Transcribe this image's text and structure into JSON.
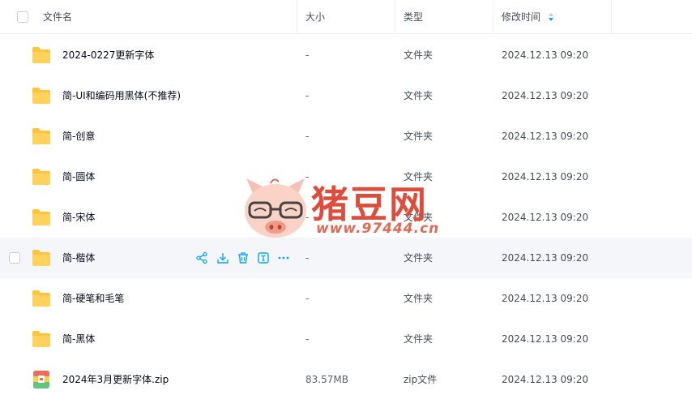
{
  "header": {
    "name_label": "文件名",
    "size_label": "大小",
    "type_label": "类型",
    "time_label": "修改时间"
  },
  "rows": [
    {
      "name": "2024-0227更新字体",
      "size": "-",
      "type": "文件夹",
      "time": "2024.12.13 09:20",
      "icon": "folder-icon"
    },
    {
      "name": "简-UI和编码用黑体(不推荐)",
      "size": "-",
      "type": "文件夹",
      "time": "2024.12.13 09:20",
      "icon": "folder-icon"
    },
    {
      "name": "简-创意",
      "size": "-",
      "type": "文件夹",
      "time": "2024.12.13 09:20",
      "icon": "folder-icon"
    },
    {
      "name": "简-圆体",
      "size": "-",
      "type": "文件夹",
      "time": "2024.12.13 09:20",
      "icon": "folder-icon"
    },
    {
      "name": "简-宋体",
      "size": "-",
      "type": "文件夹",
      "time": "2024.12.13 09:20",
      "icon": "folder-icon"
    },
    {
      "name": "简-楷体",
      "size": "-",
      "type": "文件夹",
      "time": "2024.12.13 09:20",
      "icon": "folder-icon",
      "hovered": true
    },
    {
      "name": "简-硬笔和毛笔",
      "size": "-",
      "type": "文件夹",
      "time": "2024.12.13 09:20",
      "icon": "folder-icon"
    },
    {
      "name": "简-黑体",
      "size": "-",
      "type": "文件夹",
      "time": "2024.12.13 09:20",
      "icon": "folder-icon"
    },
    {
      "name": "2024年3月更新字体.zip",
      "size": "83.57MB",
      "type": "zip文件",
      "time": "2024.12.13 09:20",
      "icon": "zip-file-icon"
    }
  ],
  "row_actions": [
    "share-icon",
    "download-icon",
    "delete-icon",
    "rename-icon",
    "more-icon"
  ],
  "watermark": {
    "title": "猪豆网",
    "url": "www.97444.cn"
  },
  "colors": {
    "accent": "#06a7ff",
    "folder": "#ffc43d",
    "hover_row": "#f5f6fa",
    "watermark": "#dc4e3b"
  }
}
